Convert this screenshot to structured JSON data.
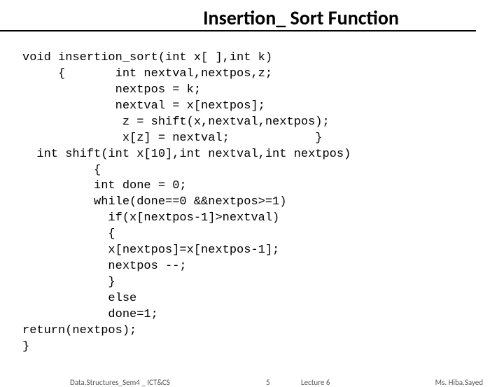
{
  "title": "Insertion_ Sort Function",
  "code": {
    "l1": "void insertion_sort(int x[ ],int k)",
    "l2": "     {       int nextval,nextpos,z;",
    "l3": "             nextpos = k;",
    "l4": "             nextval = x[nextpos];",
    "l5": "              z = shift(x,nextval,nextpos);",
    "l6": "              x[z] = nextval;            }",
    "l7": "  int shift(int x[10],int nextval,int nextpos)",
    "l8": "          {",
    "l9": "          int done = 0;",
    "l10": "          while(done==0 &&nextpos>=1)",
    "l11": "            if(x[nextpos-1]>nextval)",
    "l12": "            {",
    "l13": "            x[nextpos]=x[nextpos-1];",
    "l14": "            nextpos --;",
    "l15": "            }",
    "l16": "            else",
    "l17": "            done=1;",
    "l18": "return(nextpos);",
    "l19": "}"
  },
  "footer": {
    "left": "Data.Structures_Sem4 _ ICT&CS",
    "center": "5",
    "lecture": "Lecture 6",
    "right": "Ms. Hiba.Sayed"
  }
}
